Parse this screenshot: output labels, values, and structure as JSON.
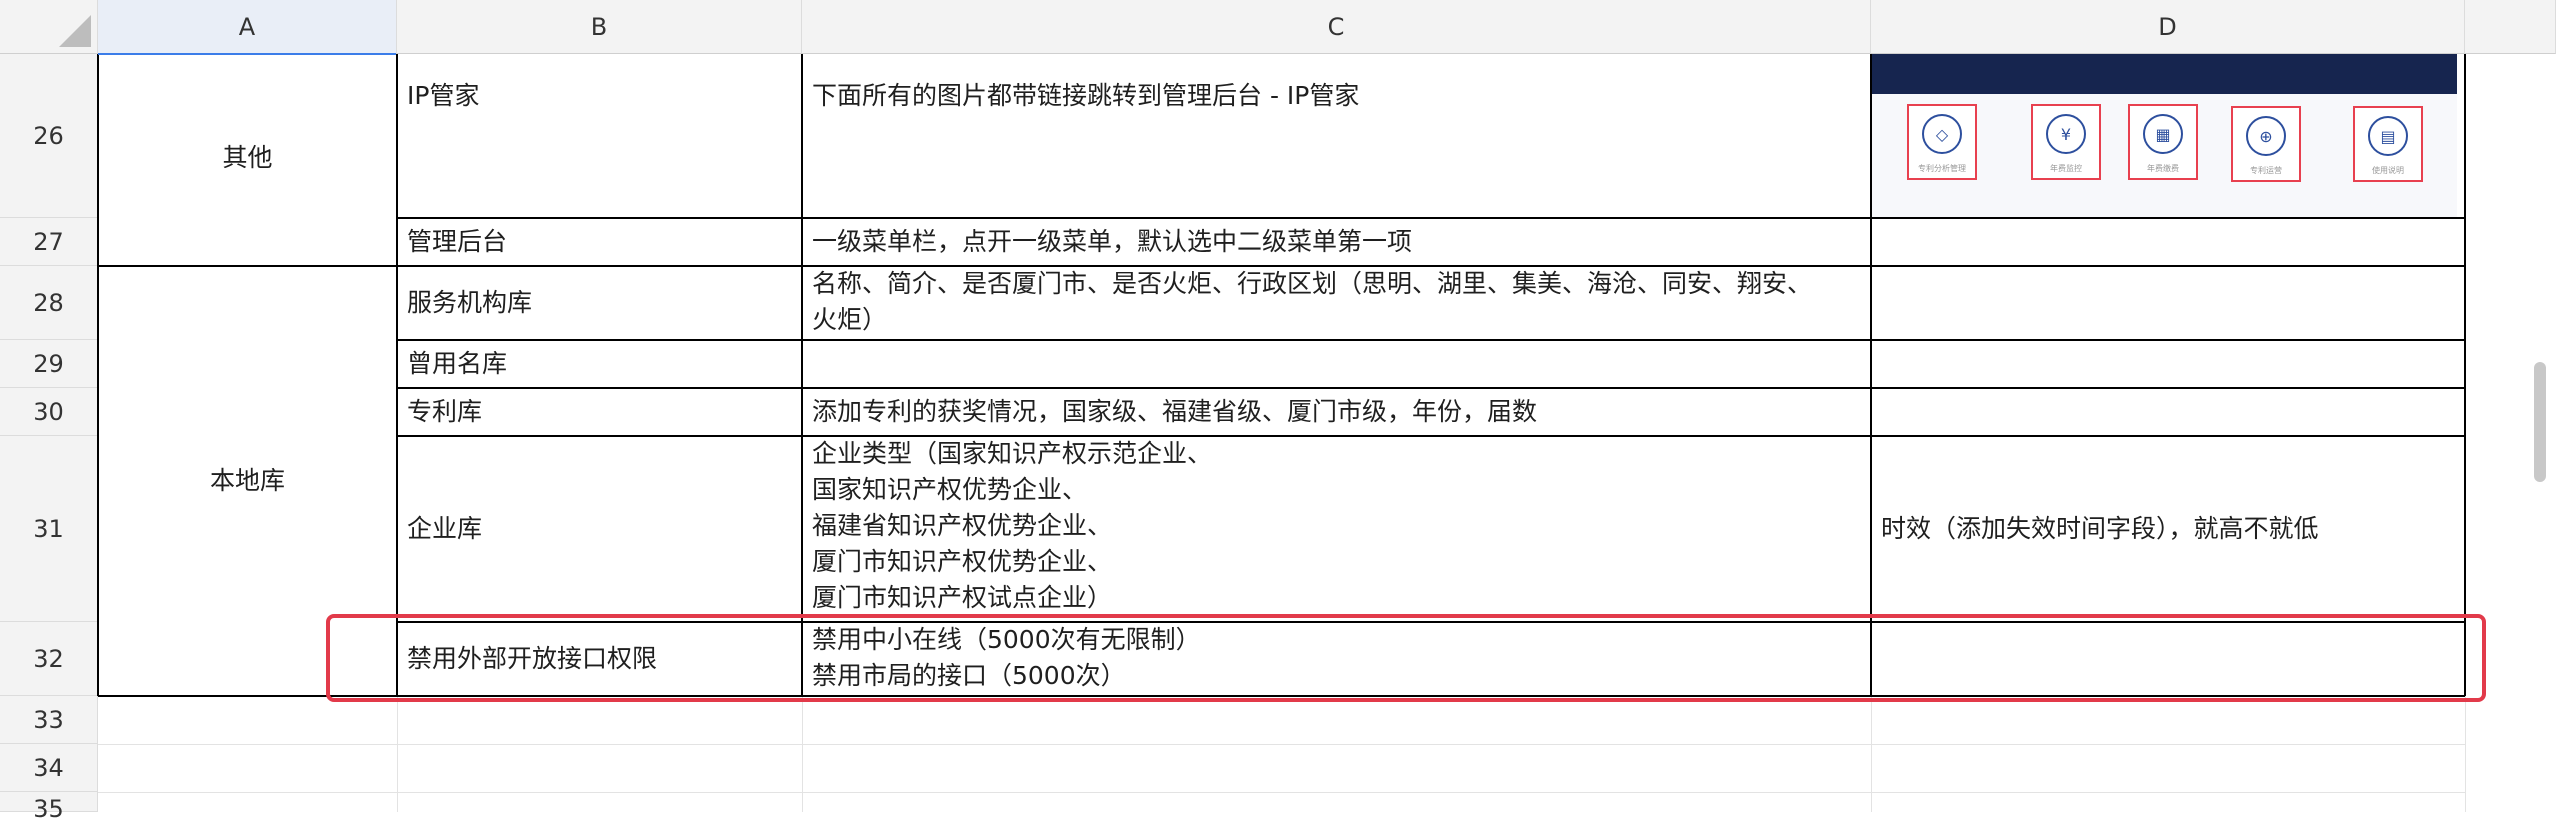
{
  "columns": [
    "A",
    "B",
    "C",
    "D"
  ],
  "rows": [
    {
      "num": "26",
      "b": "IP管家",
      "c": "下面所有的图片都带链接跳转到管理后台  -  IP管家",
      "d": ""
    },
    {
      "num": "27",
      "b": "管理后台",
      "c": "一级菜单栏，点开一级菜单，默认选中二级菜单第一项",
      "d": ""
    },
    {
      "num": "28",
      "b": "服务机构库",
      "c": "名称、简介、是否厦门市、是否火炬、行政区划（思明、湖里、集美、海沧、同安、翔安、\n火炬）",
      "d": ""
    },
    {
      "num": "29",
      "b": "曾用名库",
      "c": "",
      "d": ""
    },
    {
      "num": "30",
      "b": "专利库",
      "c": "添加专利的获奖情况，国家级、福建省级、厦门市级，年份，届数",
      "d": ""
    },
    {
      "num": "31",
      "b": "企业库",
      "c": "企业类型（国家知识产权示范企业、\n国家知识产权优势企业、\n福建省知识产权优势企业、\n厦门市知识产权优势企业、\n厦门市知识产权试点企业）",
      "d": "时效（添加失效时间字段），就高不就低"
    },
    {
      "num": "32",
      "b": "禁用外部开放接口权限",
      "c": "禁用中小在线（5000次有无限制）\n禁用市局的接口（5000次）",
      "d": ""
    },
    {
      "num": "33",
      "b": "",
      "c": "",
      "d": ""
    },
    {
      "num": "34",
      "b": "",
      "c": "",
      "d": ""
    },
    {
      "num": "35",
      "b": "",
      "c": "",
      "d": ""
    }
  ],
  "merged": {
    "group_other": "其他",
    "group_local": "本地库"
  },
  "preview_icons": [
    {
      "name": "diamond-icon",
      "glyph": "◇",
      "caption": "专利分析管理"
    },
    {
      "name": "yen-coin-icon",
      "glyph": "¥",
      "caption": "年费监控"
    },
    {
      "name": "calculator-icon",
      "glyph": "▦",
      "caption": "年费缴费"
    },
    {
      "name": "globe-yen-icon",
      "glyph": "⊕",
      "caption": "专利运营"
    },
    {
      "name": "document-icon",
      "glyph": "▤",
      "caption": "使用说明"
    }
  ],
  "colors": {
    "highlight": "#e23a4a",
    "header_bg": "#f3f3f3",
    "preview_dark": "#16254f",
    "icon_outline": "#2d4f9e"
  }
}
